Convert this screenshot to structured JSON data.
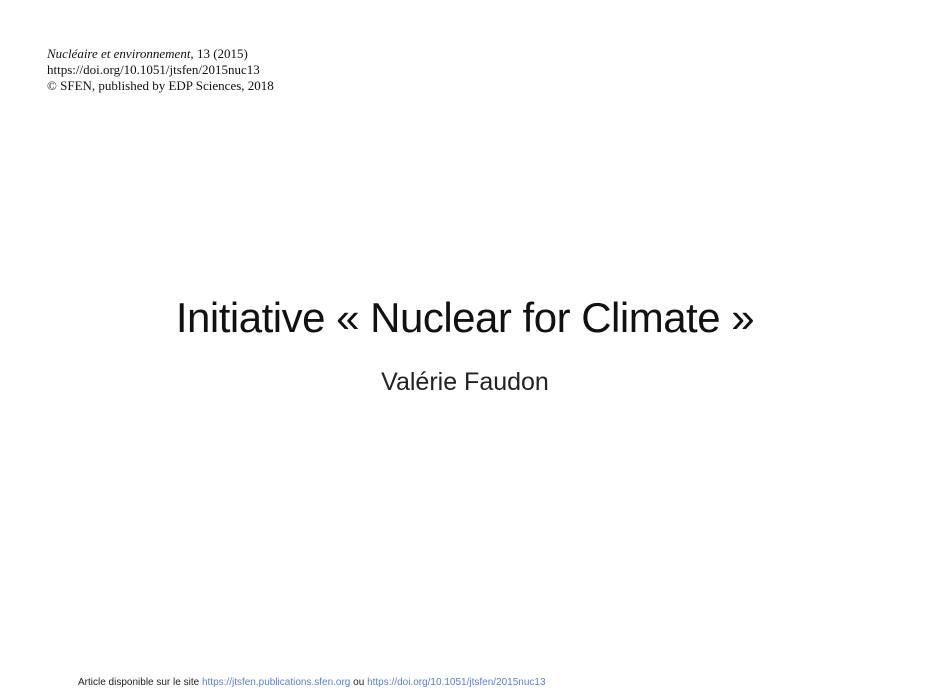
{
  "header": {
    "journal": "Nucléaire et environnement,",
    "volume_year": " 13 (2015)",
    "doi": "https://doi.org/10.1051/jtsfen/2015nuc13",
    "copyright": "© SFEN, published by EDP Sciences, 2018"
  },
  "slide": {
    "title": "Initiative « Nuclear for Climate »",
    "author": "Valérie Faudon"
  },
  "footer": {
    "prefix": "Article disponible sur le site ",
    "link1": "https://jtsfen.publications.sfen.org",
    "separator": " ou ",
    "link2": "https://doi.org/10.1051/jtsfen/2015nuc13"
  },
  "colors": {
    "link": "#5b7fd6"
  }
}
